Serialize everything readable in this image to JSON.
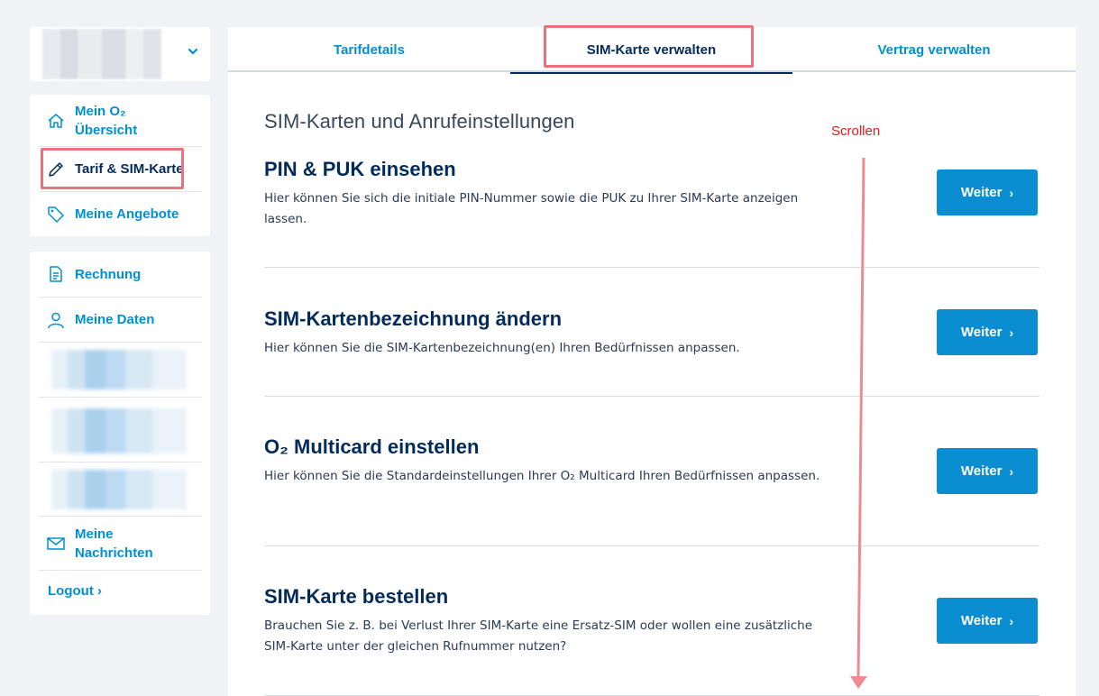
{
  "sidebar": {
    "group1": [
      {
        "label_line1": "Mein O₂",
        "label_line2": "Übersicht",
        "icon": "home-icon"
      },
      {
        "label": "Tarif & SIM-Karte",
        "icon": "pencil-icon",
        "active": true
      },
      {
        "label": "Meine Angebote",
        "icon": "tag-icon"
      }
    ],
    "group2": [
      {
        "label": "Rechnung",
        "icon": "document-icon"
      },
      {
        "label": "Meine Daten",
        "icon": "user-icon"
      },
      {
        "label_line1": "Meine",
        "label_line2": "Nachrichten",
        "icon": "mail-icon"
      }
    ],
    "logout": "Logout ›"
  },
  "tabs": [
    {
      "label": "Tarifdetails"
    },
    {
      "label": "SIM-Karte verwalten",
      "active": true
    },
    {
      "label": "Vertrag verwalten"
    }
  ],
  "main": {
    "section_title": "SIM-Karten und Anrufeinstellungen",
    "scroll_note": "Scrollen",
    "cards": [
      {
        "title": "PIN & PUK einsehen",
        "text": "Hier können Sie sich die initiale PIN-Nummer sowie die PUK zu Ihrer SIM-Karte anzeigen lassen.",
        "button": "Weiter"
      },
      {
        "title": "SIM-Kartenbezeichnung ändern",
        "text": "Hier können Sie die SIM-Kartenbezeichnung(en) Ihren Bedürfnissen anpassen.",
        "button": "Weiter"
      },
      {
        "title": "O₂ Multicard einstellen",
        "text": "Hier können Sie die Standardeinstellungen Ihrer O₂ Multicard Ihren Bedürfnissen anpassen.",
        "button": "Weiter"
      },
      {
        "title": "SIM-Karte bestellen",
        "text": "Brauchen Sie z. B. bei Verlust Ihrer SIM-Karte eine Ersatz-SIM oder wollen eine zusätzliche SIM-Karte unter der gleichen Rufnummer nutzen?",
        "button": "Weiter"
      }
    ]
  },
  "colors": {
    "accent": "#0090d0",
    "navy": "#032b5a",
    "button": "#0a8ed1",
    "annotation": "#e8737d",
    "scroll_text": "#e01a1a"
  }
}
